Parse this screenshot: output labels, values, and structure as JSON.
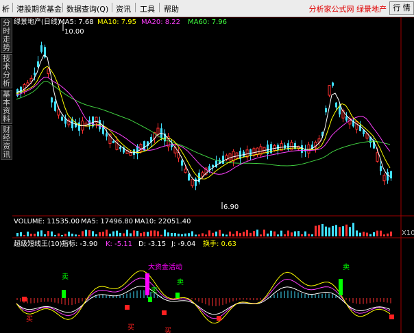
{
  "menubar": {
    "items": [
      {
        "label": "析"
      },
      {
        "label": "港股期货基金"
      },
      {
        "label": "数据查询(Q)"
      },
      {
        "label": "资讯"
      },
      {
        "label": "工具"
      },
      {
        "label": "帮助"
      }
    ],
    "brand": "分析家公式网 绿景地产",
    "right_button": "行 情"
  },
  "side_tabs": [
    "分时走势",
    "技术分析",
    "基本资料",
    "财经资讯"
  ],
  "price_panel": {
    "stock_name": "绿景地产(日线)",
    "indicators": [
      {
        "label": "MA5: 7.68",
        "color": "#ffffff"
      },
      {
        "label": "MA10: 7.95",
        "color": "#ffff00"
      },
      {
        "label": "MA20: 8.22",
        "color": "#ff40ff"
      },
      {
        "label": "MA60: 7.96",
        "color": "#40ff40"
      }
    ],
    "high_label": "10.00",
    "low_label": "6.90"
  },
  "volume_panel": {
    "indicators": [
      {
        "label": "VOLUME: 11535.00",
        "color": "#ffffff"
      },
      {
        "label": "MA5: 17496.80",
        "color": "#ffffff"
      },
      {
        "label": "MA10: 22051.40",
        "color": "#ffffff"
      }
    ],
    "axis_label": "X10"
  },
  "indicator_panel": {
    "title": "超级短线王(10)",
    "indicators": [
      {
        "label": "指标: -3.90",
        "color": "#ffffff"
      },
      {
        "label": "K: -5.11",
        "color": "#ff40ff"
      },
      {
        "label": "D: -3.15",
        "color": "#ffffff"
      },
      {
        "label": "J: -9.04",
        "color": "#ffffff"
      },
      {
        "label": "换手: 0.63",
        "color": "#ffff00"
      }
    ],
    "signals": {
      "buy": "买",
      "sell": "卖",
      "big_money": "大资金活动"
    }
  }
}
